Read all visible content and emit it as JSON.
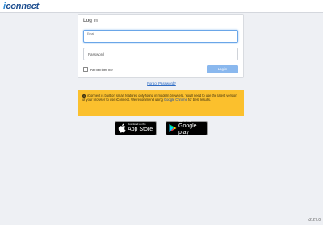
{
  "app": {
    "logo_prefix": "i",
    "logo_text": "connect"
  },
  "login": {
    "header": "Log in",
    "email_label": "Email",
    "password_placeholder": "Password",
    "remember_label": "Remember me",
    "login_button": "Log in",
    "remember_checked": false
  },
  "forgot_password": "Forgot Password?",
  "notice": {
    "text_before": "iConnect is built on smart features only found in modern browsers. You'll need to use the latest version of your browser to use iConnect. We recommend using",
    "link_text": "Google Chrome",
    "text_after": "for best results."
  },
  "stores": {
    "apple_small": "Download on the",
    "apple_big": "App Store",
    "google_small": "GET IT ON",
    "google_big": "Google play"
  },
  "version": "v2.27.0",
  "colors": {
    "accent": "#8ab8ee",
    "notice_bg": "#fbc02d",
    "link": "#2d6bc4"
  }
}
